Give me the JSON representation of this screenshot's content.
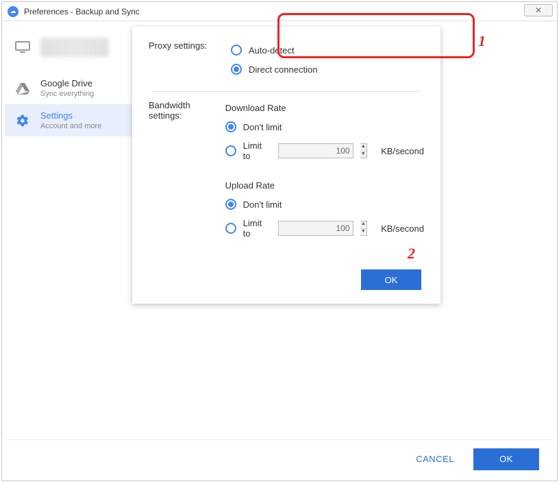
{
  "window": {
    "title": "Preferences - Backup and Sync",
    "close_glyph": "✕"
  },
  "sidebar": {
    "items": [
      {
        "title": "",
        "sub": "",
        "icon": "monitor"
      },
      {
        "title": "Google Drive",
        "sub": "Sync everything",
        "icon": "drive"
      },
      {
        "title": "Settings",
        "sub": "Account and more",
        "icon": "gear"
      }
    ]
  },
  "proxy": {
    "label": "Proxy settings:",
    "auto_detect": "Auto-detect",
    "direct": "Direct connection",
    "selected": "direct"
  },
  "bandwidth": {
    "label": "Bandwidth settings:",
    "download": {
      "heading": "Download Rate",
      "dont_limit": "Don't limit",
      "limit_to": "Limit to",
      "value": "100",
      "unit": "KB/second",
      "selected": "dont_limit"
    },
    "upload": {
      "heading": "Upload Rate",
      "dont_limit": "Don't limit",
      "limit_to": "Limit to",
      "value": "100",
      "unit": "KB/second",
      "selected": "dont_limit"
    }
  },
  "panel_ok": "OK",
  "footer": {
    "cancel": "CANCEL",
    "ok": "OK"
  },
  "annotations": {
    "one": "1",
    "two": "2"
  }
}
